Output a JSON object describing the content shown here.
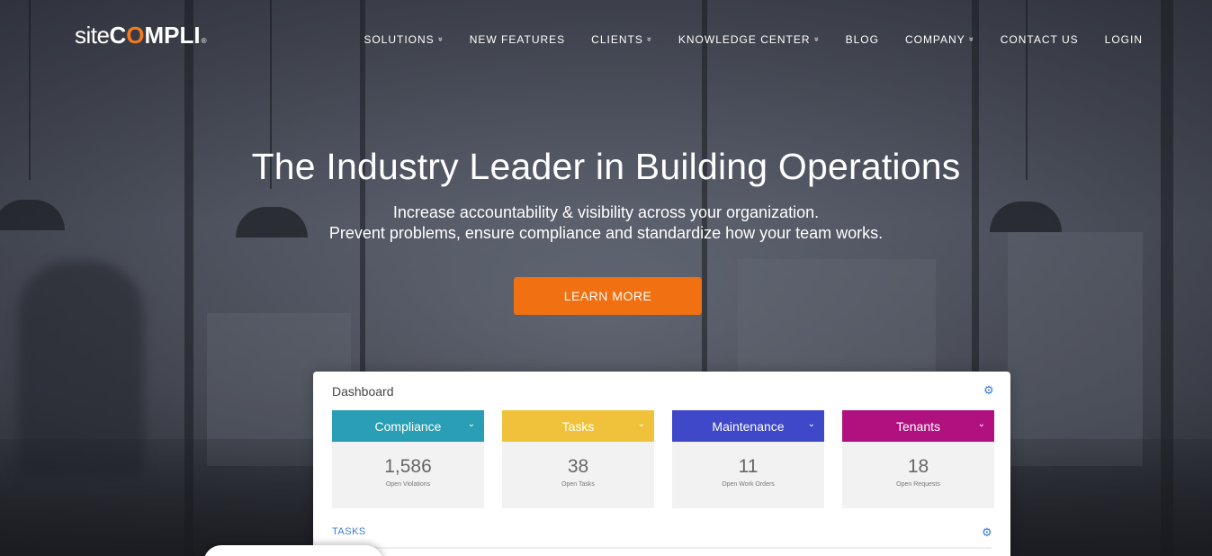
{
  "logo": {
    "site": "site",
    "compli_pre": "C",
    "compli_check": "O",
    "compli_post": "MPLI",
    "reg": "®"
  },
  "nav": {
    "items": [
      {
        "label": "SOLUTIONS",
        "dropdown": true
      },
      {
        "label": "NEW FEATURES",
        "dropdown": false
      },
      {
        "label": "CLIENTS",
        "dropdown": true
      },
      {
        "label": "KNOWLEDGE CENTER",
        "dropdown": true
      },
      {
        "label": "BLOG",
        "dropdown": false
      },
      {
        "label": "COMPANY",
        "dropdown": true
      },
      {
        "label": "CONTACT US",
        "dropdown": false
      },
      {
        "label": "LOGIN",
        "dropdown": false
      }
    ],
    "chevron": "»"
  },
  "hero": {
    "title": "The Industry Leader in Building Operations",
    "subtitle_line1": "Increase accountability & visibility across your organization.",
    "subtitle_line2": "Prevent problems, ensure compliance and standardize how your team works.",
    "cta": "LEARN MORE"
  },
  "dashboard": {
    "title": "Dashboard",
    "tiles": [
      {
        "label": "Compliance",
        "value": "1,586",
        "caption": "Open Violations",
        "color": "#2a9eb4"
      },
      {
        "label": "Tasks",
        "value": "38",
        "caption": "Open Tasks",
        "color": "#f0c23b"
      },
      {
        "label": "Maintenance",
        "value": "11",
        "caption": "Open Work Orders",
        "color": "#3f48c8"
      },
      {
        "label": "Tenants",
        "value": "18",
        "caption": "Open Requests",
        "color": "#b0117f"
      }
    ],
    "tasks_label": "TASKS"
  },
  "colors": {
    "accent": "#f07012",
    "link": "#3a7bd5"
  },
  "icons": {
    "gear": "gear-icon",
    "dropdown": "chevron-down-icon"
  }
}
